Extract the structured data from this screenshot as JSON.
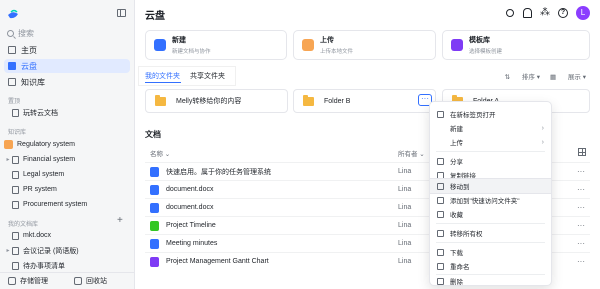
{
  "sidebar": {
    "search_placeholder": "搜索",
    "nav": [
      {
        "label": "主页"
      },
      {
        "label": "云盘"
      },
      {
        "label": "知识库"
      }
    ],
    "recent_label": "置顶",
    "recent_item": "玩转云文档",
    "kb_label": "知识库",
    "kb_items": [
      {
        "label": "Regulatory system"
      },
      {
        "label": "Financial system"
      },
      {
        "label": "Legal system"
      },
      {
        "label": "PR system"
      },
      {
        "label": "Procurement system"
      }
    ],
    "my_docs_label": "我的文档库",
    "my_docs_items": [
      {
        "label": "mkt.docx"
      },
      {
        "label": "会议记录 (简语版)"
      },
      {
        "label": "待办事项清单"
      }
    ],
    "bottom": {
      "storage": "存储管理",
      "recycle": "回收站"
    }
  },
  "main": {
    "title": "云盘",
    "avatar_letter": "L",
    "cards": [
      {
        "title": "新建",
        "desc": "新建文档与协作",
        "color": "#3370ff"
      },
      {
        "title": "上传",
        "desc": "上传本地文件",
        "color": "#f7a553"
      },
      {
        "title": "模板库",
        "desc": "选择模板创建",
        "color": "#7f3bf5"
      }
    ],
    "tabs": {
      "mine": "我的文件夹",
      "shared": "共享文件夹"
    },
    "sort": {
      "sort_label": "排序",
      "view_label": "展示"
    },
    "folders": [
      {
        "name": "Melly转移给你的内容"
      },
      {
        "name": "Folder B"
      },
      {
        "name": "Folder A"
      }
    ],
    "more_label": "···",
    "docs_title": "文档",
    "columns": {
      "name": "名称",
      "owner": "所有者"
    },
    "rows": [
      {
        "name": "快速启用。属于你的任务管理系统",
        "owner": "Lina",
        "color": "#3370ff"
      },
      {
        "name": "document.docx",
        "owner": "Lina",
        "color": "#3370ff"
      },
      {
        "name": "document.docx",
        "owner": "Lina",
        "color": "#3370ff"
      },
      {
        "name": "Project Timeline",
        "owner": "Lina",
        "color": "#34c724"
      },
      {
        "name": "Meeting minutes",
        "owner": "Lina",
        "color": "#3370ff"
      },
      {
        "name": "Project Management Gantt Chart",
        "owner": "Lina",
        "color": "#7f3bf5"
      }
    ]
  },
  "context_menu": {
    "items": [
      {
        "label": "在新标签页打开",
        "submenu": false
      },
      {
        "label": "新建",
        "submenu": true
      },
      {
        "label": "上传",
        "submenu": true
      },
      {
        "label": "分享",
        "submenu": false
      },
      {
        "label": "复制链接",
        "submenu": false
      },
      {
        "label": "移动到",
        "submenu": false
      },
      {
        "label": "添加到\"快速访问文件夹\"",
        "submenu": false
      },
      {
        "label": "收藏",
        "submenu": false
      },
      {
        "label": "转移所有权",
        "submenu": false
      },
      {
        "label": "下载",
        "submenu": false
      },
      {
        "label": "重命名",
        "submenu": false
      },
      {
        "label": "删除",
        "submenu": false
      }
    ]
  }
}
